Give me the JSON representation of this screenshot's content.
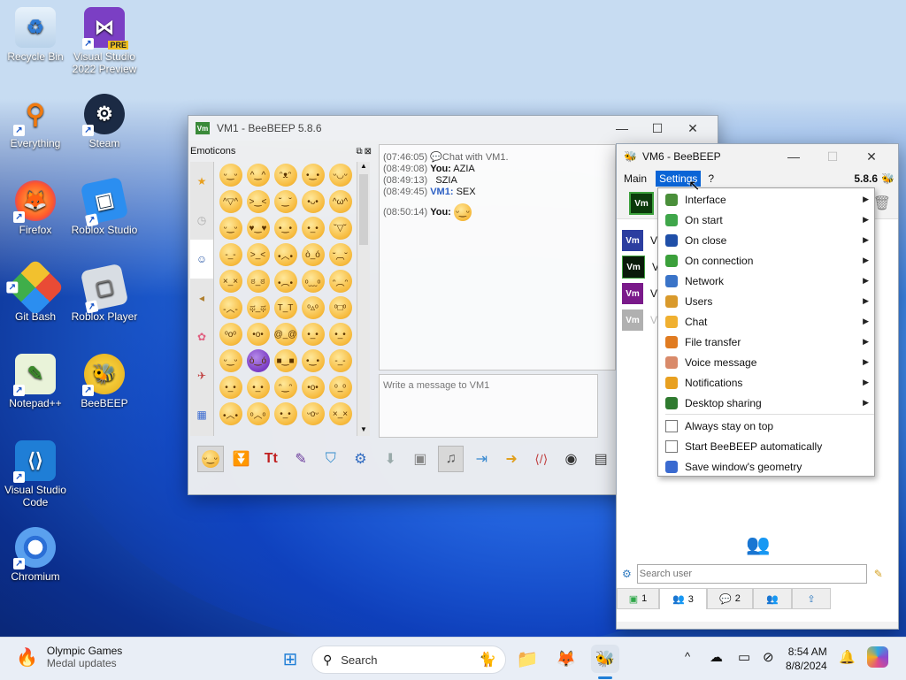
{
  "desktop": {
    "icons": [
      {
        "label": "Recycle Bin",
        "icon": "recycle-bin-icon"
      },
      {
        "label": "Visual Studio 2022 Preview",
        "icon": "visual-studio-preview-icon",
        "badge": "PRE"
      },
      {
        "label": "Everything",
        "icon": "everything-search-icon"
      },
      {
        "label": "Steam",
        "icon": "steam-icon"
      },
      {
        "label": "Firefox",
        "icon": "firefox-icon"
      },
      {
        "label": "Roblox Studio",
        "icon": "roblox-studio-icon"
      },
      {
        "label": "Git Bash",
        "icon": "git-bash-icon"
      },
      {
        "label": "Roblox Player",
        "icon": "roblox-player-icon"
      },
      {
        "label": "Notepad++",
        "icon": "notepad-plus-plus-icon"
      },
      {
        "label": "BeeBEEP",
        "icon": "beebeep-icon"
      },
      {
        "label": "Visual Studio Code",
        "icon": "vscode-icon"
      },
      {
        "label": "Chromium",
        "icon": "chromium-icon"
      }
    ]
  },
  "vm1_window": {
    "title": "VM1 - BeeBEEP 5.8.6",
    "badge": "Vm",
    "emoticons_title": "Emoticons",
    "chat_lines": [
      {
        "time": "(07:46:05)",
        "sender": "",
        "text": "Chat with VM1."
      },
      {
        "time": "(08:49:08)",
        "sender": "You:",
        "text": "AZIA"
      },
      {
        "time": "(08:49:13)",
        "sender": "",
        "text": "SZIA"
      },
      {
        "time": "(08:49:45)",
        "sender": "VM1:",
        "text": "SEX"
      },
      {
        "time": "(08:50:14)",
        "sender": "You:",
        "text": ""
      }
    ],
    "message_placeholder": "Write a message to VM1"
  },
  "vm6_window": {
    "title": "VM6 - BeeBEEP",
    "version": "5.8.6",
    "menubar": [
      "Main",
      "Settings",
      "?"
    ],
    "badge": "Vm",
    "users_partial": [
      "V",
      "V",
      "V",
      "V"
    ],
    "search_placeholder": "Search user",
    "tabs": [
      {
        "count": "1",
        "icon": "chat-tab-icon"
      },
      {
        "count": "3",
        "icon": "users-tab-icon"
      },
      {
        "count": "2",
        "icon": "groups-tab-icon"
      },
      {
        "count": "",
        "icon": "network-tab-icon"
      },
      {
        "count": "",
        "icon": "share-tab-icon"
      }
    ]
  },
  "settings_menu": {
    "items": [
      {
        "label": "Interface",
        "submenu": true,
        "icon": "interface-icon",
        "color": "#4a8f3a"
      },
      {
        "label": "On start",
        "submenu": true,
        "icon": "on-start-icon",
        "color": "#3fa64a"
      },
      {
        "label": "On close",
        "submenu": true,
        "icon": "on-close-icon",
        "color": "#1f4fa8"
      },
      {
        "label": "On connection",
        "submenu": true,
        "icon": "on-connection-icon",
        "color": "#3ba03b"
      },
      {
        "label": "Network",
        "submenu": true,
        "icon": "network-icon",
        "color": "#3a74c8"
      },
      {
        "label": "Users",
        "submenu": true,
        "icon": "users-icon",
        "color": "#d99a2b"
      },
      {
        "label": "Chat",
        "submenu": true,
        "icon": "chat-icon",
        "color": "#f0b030"
      },
      {
        "label": "File transfer",
        "submenu": true,
        "icon": "file-transfer-icon",
        "color": "#e07b20"
      },
      {
        "label": "Voice message",
        "submenu": true,
        "icon": "voice-message-icon",
        "color": "#d98a6a"
      },
      {
        "label": "Notifications",
        "submenu": true,
        "icon": "notifications-icon",
        "color": "#e8a020"
      },
      {
        "label": "Desktop sharing",
        "submenu": true,
        "icon": "desktop-sharing-icon",
        "color": "#2f7a2f"
      }
    ],
    "checks": [
      {
        "label": "Always stay on top",
        "checked": false
      },
      {
        "label": "Start BeeBEEP automatically",
        "checked": false
      }
    ],
    "save_geometry_label": "Save window's geometry"
  },
  "taskbar": {
    "news_title": "Olympic Games",
    "news_subtitle": "Medal updates",
    "search_label": "Search",
    "time": "8:54 AM",
    "date": "8/8/2024",
    "chevron": "^"
  }
}
